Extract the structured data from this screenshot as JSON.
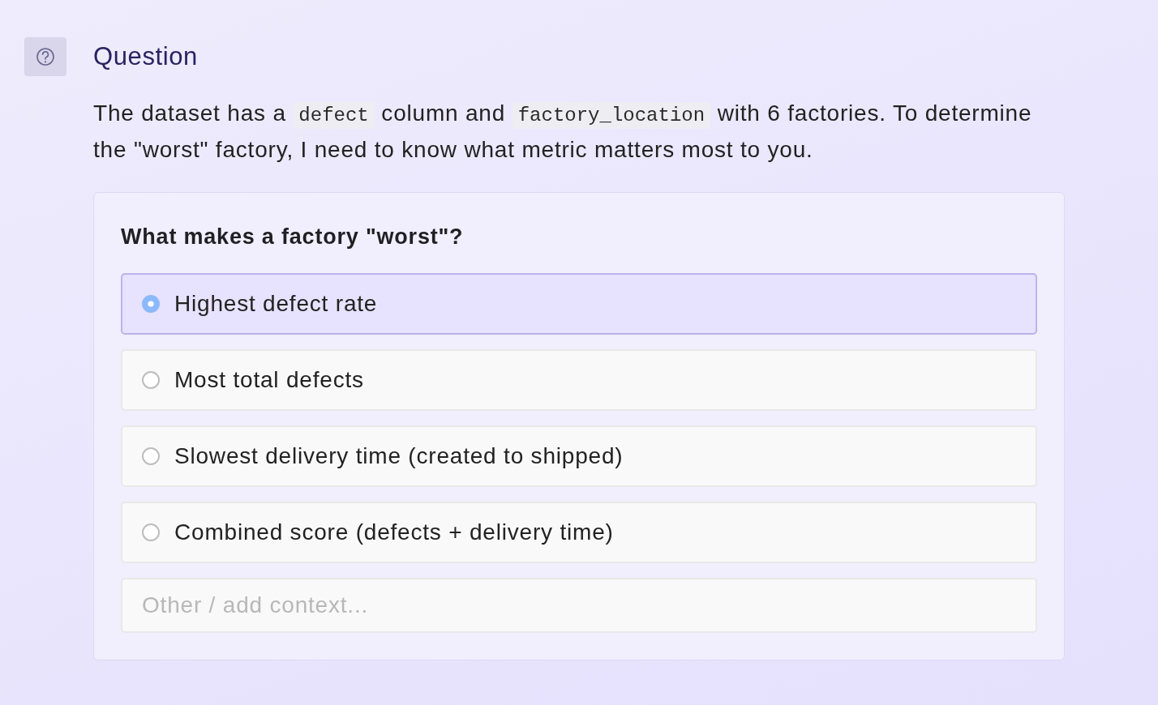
{
  "header": {
    "title": "Question"
  },
  "description": [
    {
      "kind": "text",
      "text": "The dataset has a "
    },
    {
      "kind": "code",
      "text": "defect"
    },
    {
      "kind": "text",
      "text": " column and "
    },
    {
      "kind": "code",
      "text": "factory_location"
    },
    {
      "kind": "text",
      "text": " with 6 factories. To determine the \"worst\" factory, I need to know what metric matters most to you."
    }
  ],
  "question_card": {
    "prompt": "What makes a factory \"worst\"?",
    "options": [
      {
        "label": "Highest defect rate",
        "selected": true
      },
      {
        "label": "Most total defects",
        "selected": false
      },
      {
        "label": "Slowest delivery time (created to shipped)",
        "selected": false
      },
      {
        "label": "Combined score (defects + delivery time)",
        "selected": false
      }
    ],
    "other_input": {
      "placeholder": "Other / add context..."
    }
  }
}
